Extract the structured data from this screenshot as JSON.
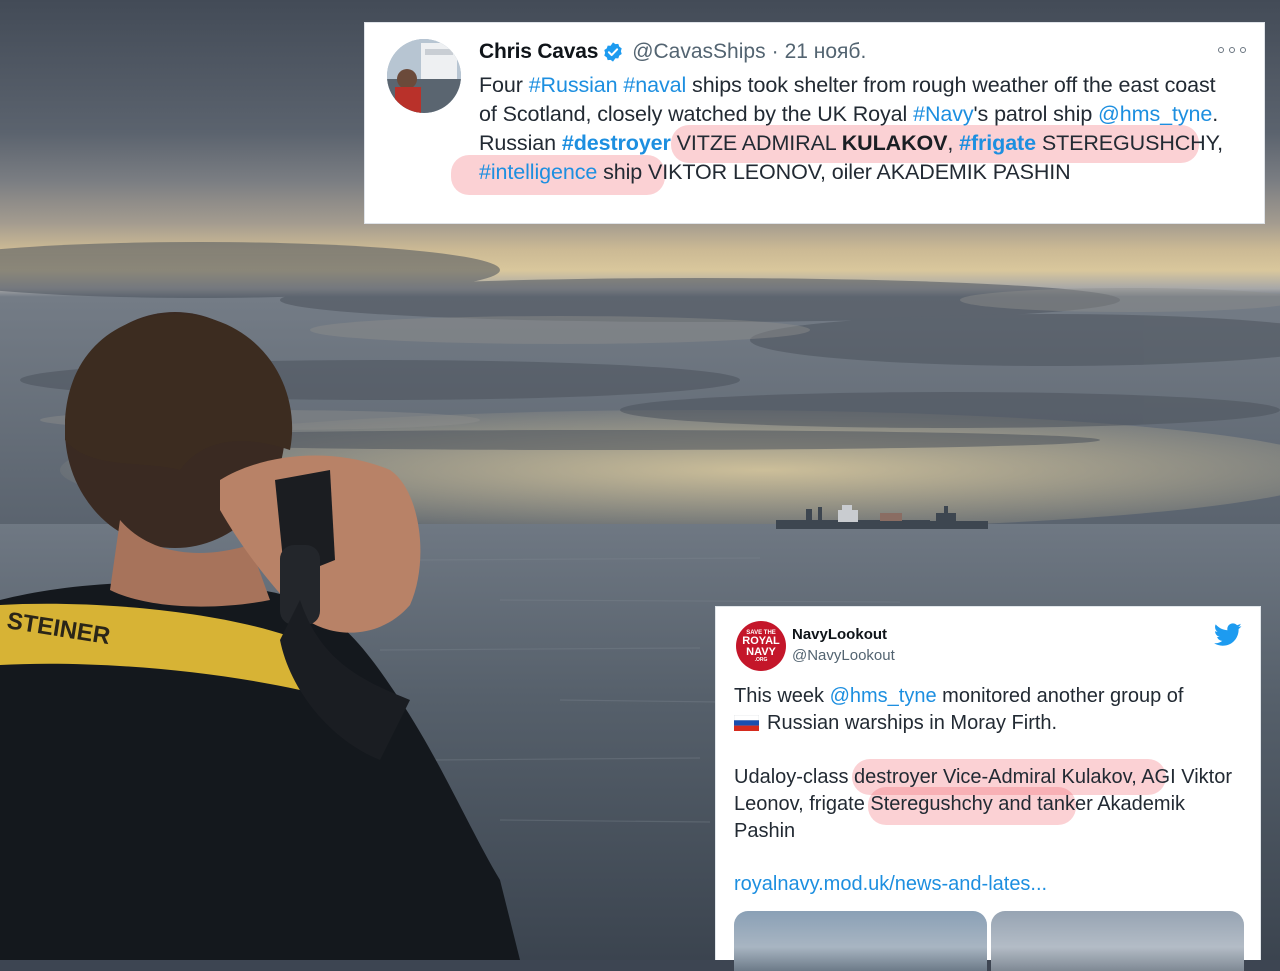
{
  "tweet_top": {
    "name": "Chris Cavas",
    "handle": "@CavasShips",
    "separator": "·",
    "date": "21 нояб.",
    "text": {
      "w1": "Four ",
      "h_russian": "#Russian",
      "sp1": " ",
      "h_naval": "#naval",
      "w2": " ships took shelter from rough weather off the east coast of Scotland, closely watched by the UK Royal ",
      "h_navy": "#Navy",
      "w3": "'s patrol ship ",
      "m_hms": "@hms_tyne",
      "w4": ". Russian ",
      "h_destroyer": "#destroyer",
      "w5": " VITZE ADMIRAL ",
      "kulakov": "KULAKOV",
      "w6": ", ",
      "h_frigate": "#frigate",
      "w7": " STEREGUSHCHY, ",
      "h_intel": "#intelligence",
      "w8": " ship VIKTOR LEONOV, oiler AKADEMIK PASHIN"
    }
  },
  "tweet_bottom": {
    "name": "NavyLookout",
    "handle": "@NavyLookout",
    "avatar_text": {
      "line1": "SAVE THE",
      "line2": "ROYAL",
      "line3": "NAVY",
      "line4": ".ORG"
    },
    "p1": {
      "w1": "This week ",
      "mention": "@hms_tyne",
      "w2": " monitored another group of",
      "w3": "Russian warships in Moray Firth."
    },
    "p2": {
      "w1": "Udaloy-class ",
      "w2": "destroyer Vice-Admiral Kulakov,",
      "w3": " AGI Viktor Leonov, ",
      "w4": "frigate Steregushchy",
      "w5": " and tanker Akademik Pashin"
    },
    "link": "royalnavy.mod.uk/news-and-lates..."
  },
  "background_photo": {
    "binocular_strap_text": "STEINER"
  },
  "colors": {
    "link_blue": "#1d8fe0",
    "highlight": "rgba(240,90,100,0.28)",
    "verified_blue": "#1d9bf0",
    "twitter_blue": "#1d9bf0"
  },
  "icons": [
    "verified-badge-icon",
    "more-options-icon",
    "twitter-bird-icon",
    "russia-flag-icon"
  ]
}
